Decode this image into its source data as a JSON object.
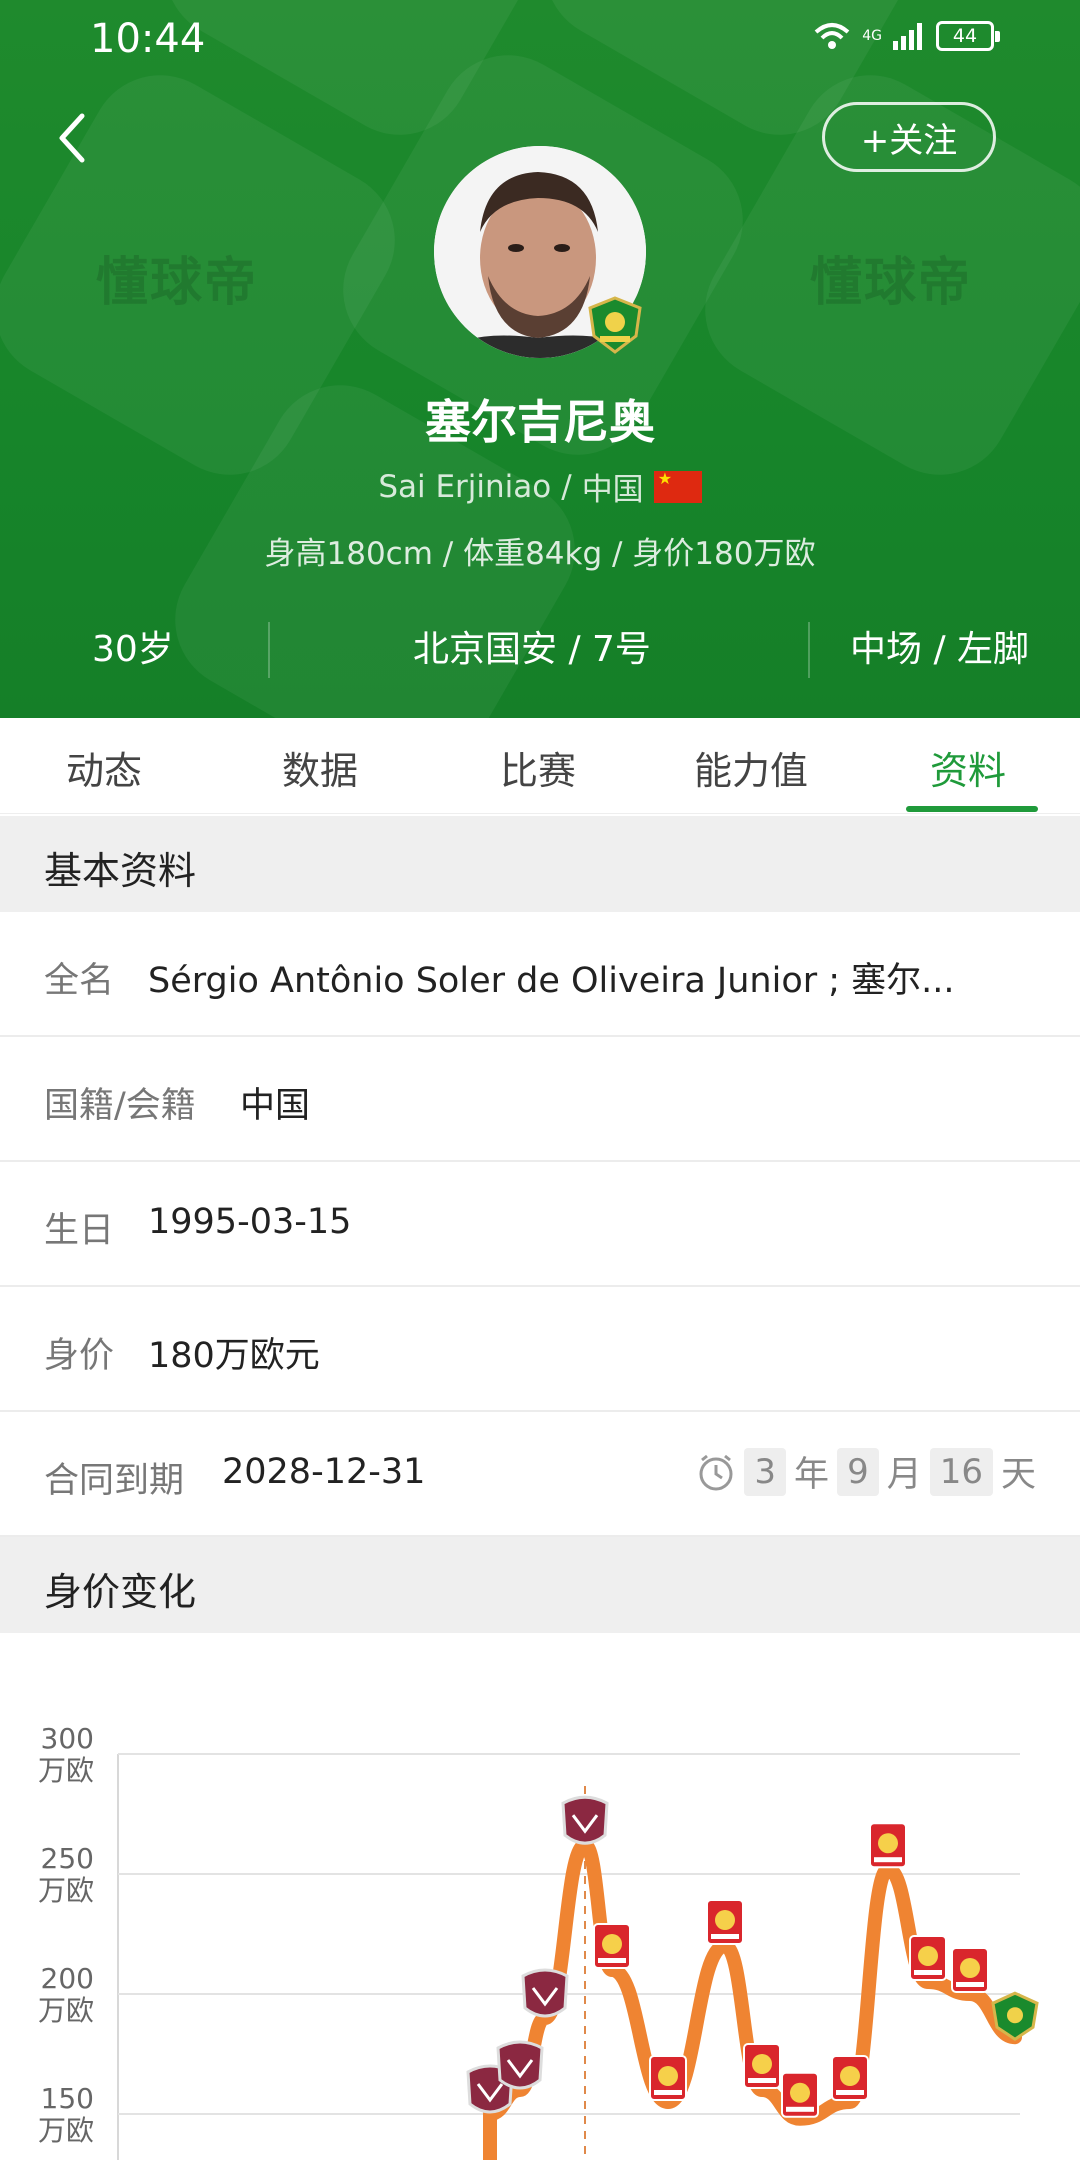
{
  "status": {
    "time": "10:44",
    "network": "4G",
    "battery": "44"
  },
  "header": {
    "follow_label": "+关注",
    "name_cn": "塞尔吉尼奥",
    "name_en": "Sai Erjiniao",
    "nationality": "中国",
    "stats_line": "身高180cm / 体重84kg / 身价180万欧",
    "watermark": "懂球帝",
    "age": "30岁",
    "club_number": "北京国安 / 7号",
    "position_foot": "中场 / 左脚"
  },
  "tabs": [
    "动态",
    "数据",
    "比赛",
    "能力值",
    "资料"
  ],
  "active_tab": "资料",
  "basic": {
    "title": "基本资料",
    "full_name_label": "全名",
    "full_name": "Sérgio Antônio Soler de Oliveira Junior ; 塞尔...",
    "nationality_label": "国籍/会籍",
    "nationality": "中国",
    "birthday_label": "生日",
    "birthday": "1995-03-15",
    "value_label": "身价",
    "value": "180万欧元",
    "contract_label": "合同到期",
    "contract": "2028-12-31",
    "countdown": {
      "years": "3",
      "years_unit": "年",
      "months": "9",
      "months_unit": "月",
      "days": "16",
      "days_unit": "天"
    }
  },
  "value_section_title": "身价变化",
  "colors": {
    "green": "#1f8a2d",
    "accent": "#1f9a3a",
    "line": "#ef8432"
  },
  "chart_data": {
    "type": "line",
    "y_unit": "万欧",
    "y_ticks": [
      "300",
      "250",
      "200",
      "150"
    ],
    "ylim": [
      130,
      300
    ],
    "grid": true,
    "values": [
      150,
      160,
      190,
      262,
      210,
      155,
      220,
      160,
      148,
      155,
      252,
      205,
      200,
      182
    ]
  }
}
